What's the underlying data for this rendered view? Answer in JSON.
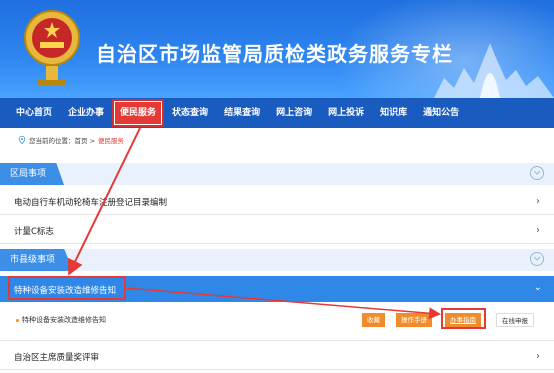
{
  "banner": {
    "title": "自治区市场监管局质检类政务服务专栏"
  },
  "nav": {
    "items": [
      "中心首页",
      "企业办事",
      "便民服务",
      "状态查询",
      "结果查询",
      "网上咨询",
      "网上投诉",
      "知识库",
      "通知公告"
    ],
    "active_index": 2
  },
  "breadcrumb": {
    "prefix": "您当前的位置：首页 >",
    "current": "便民服务"
  },
  "sections": {
    "district": {
      "label": "区局事项"
    },
    "city": {
      "label": "市县级事项"
    }
  },
  "rows": {
    "row1": "电动自行车机动轮椅车注册登记目录编制",
    "row2": "计量C标志",
    "open": "特种设备安装改造维修告知",
    "sub": "特种设备安装改造维修告知",
    "last": "自治区主席质量奖评审"
  },
  "buttons": {
    "favorite": "收藏",
    "manual": "操作手册",
    "guide": "办事指南",
    "apply": "在线申报"
  },
  "colors": {
    "nav": "#1a5bbf",
    "accent": "#e53935",
    "section": "#3d8ee6",
    "orange": "#f08c2c"
  }
}
